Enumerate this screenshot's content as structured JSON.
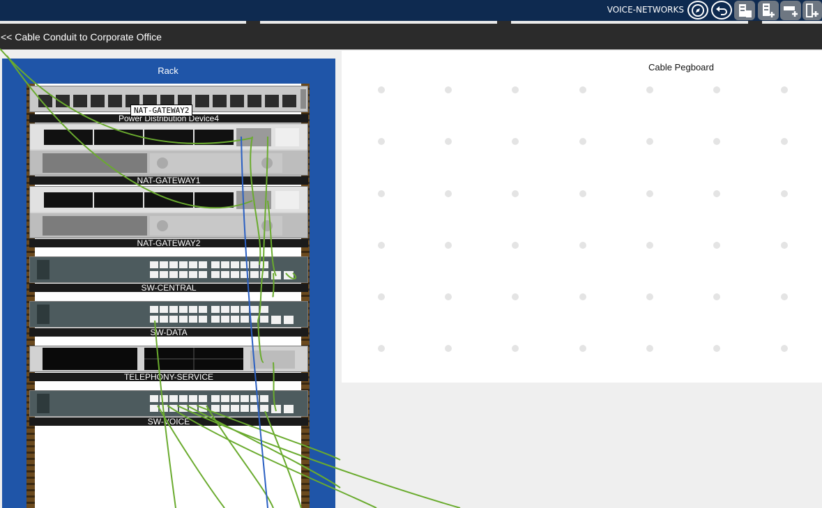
{
  "header": {
    "workspace_label": "VOICE-NETWORKS",
    "icons": [
      "navigate-icon",
      "back-icon",
      "add-rack-device-icon",
      "add-device-icon",
      "add-shelf-device-icon",
      "add-module-icon"
    ]
  },
  "nav": {
    "back_link": "<< Cable Conduit to Corporate Office"
  },
  "rack": {
    "title": "Rack",
    "devices": [
      {
        "label": "Power Distribution Device4"
      },
      {
        "label": "NAT-GATEWAY1"
      },
      {
        "label": "NAT-GATEWAY2"
      },
      {
        "label": "SW-CENTRAL"
      },
      {
        "label": "SW-DATA"
      },
      {
        "label": "TELEPHONY-SERVICE"
      },
      {
        "label": "SW-VOICE"
      }
    ]
  },
  "tooltip": {
    "text": "NAT-GATEWAY2"
  },
  "pegboard": {
    "title": "Cable Pegboard"
  },
  "colors": {
    "topbar": "#0e2a50",
    "navbar": "#2b2b2b",
    "rack_blue": "#1f55a8",
    "cable_green": "#6aab2e",
    "cable_blue": "#2a5fc2"
  }
}
